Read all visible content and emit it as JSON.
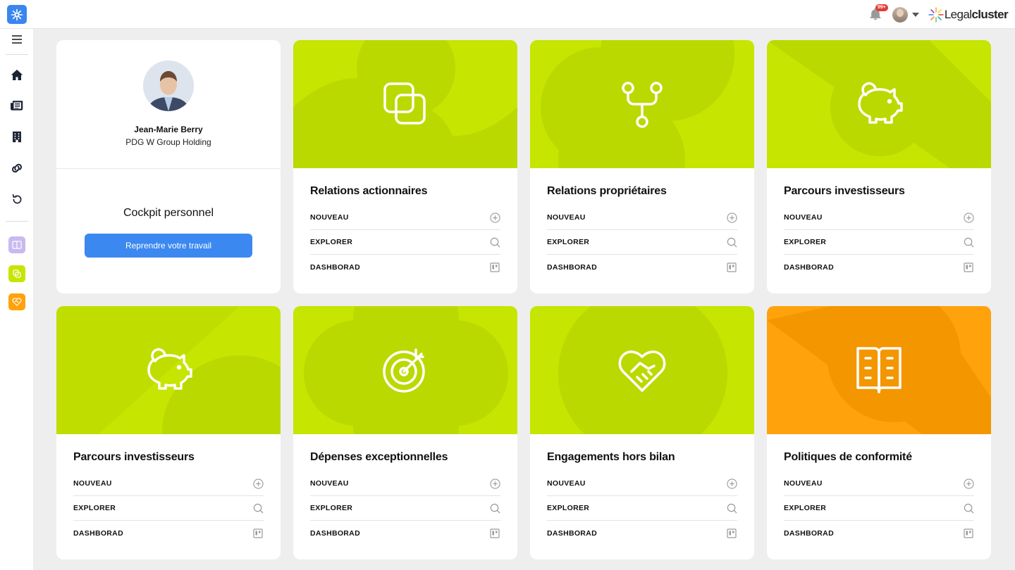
{
  "header": {
    "brand_light": "Legal",
    "brand_bold": "cluster",
    "notification_count": "99+"
  },
  "sidebar": {
    "items": [
      "menu-icon",
      "home-icon",
      "newspaper-icon",
      "building-icon",
      "link-icon",
      "history-icon"
    ],
    "apps": [
      {
        "icon": "book-icon",
        "color": "#c9b9f0"
      },
      {
        "icon": "copy-icon",
        "color": "#c6e500"
      },
      {
        "icon": "handshake-icon",
        "color": "#ffa20c"
      }
    ]
  },
  "profile": {
    "name": "Jean-Marie Berry",
    "role": "PDG W Group Holding",
    "cockpit_title": "Cockpit personnel",
    "resume_label": "Reprendre votre travail"
  },
  "actions": {
    "new": "NOUVEAU",
    "explore": "EXPLORER",
    "dashboard": "DASHBORAD"
  },
  "modules": [
    {
      "title": "Relations actionnaires",
      "icon": "copy-icon",
      "color": "#c6e500"
    },
    {
      "title": "Relations propriétaires",
      "icon": "fork-icon",
      "color": "#c6e500"
    },
    {
      "title": "Parcours investisseurs",
      "icon": "piggy-bank-icon",
      "color": "#c6e500"
    },
    {
      "title": "Parcours investisseurs",
      "icon": "piggy-bank-icon",
      "color": "#c6e500"
    },
    {
      "title": "Dépenses exceptionnelles",
      "icon": "target-icon",
      "color": "#c6e500"
    },
    {
      "title": "Engagements hors bilan",
      "icon": "handshake-heart-icon",
      "color": "#c6e500"
    },
    {
      "title": "Politiques de conformité",
      "icon": "book-icon",
      "color": "#ffa20c"
    }
  ]
}
